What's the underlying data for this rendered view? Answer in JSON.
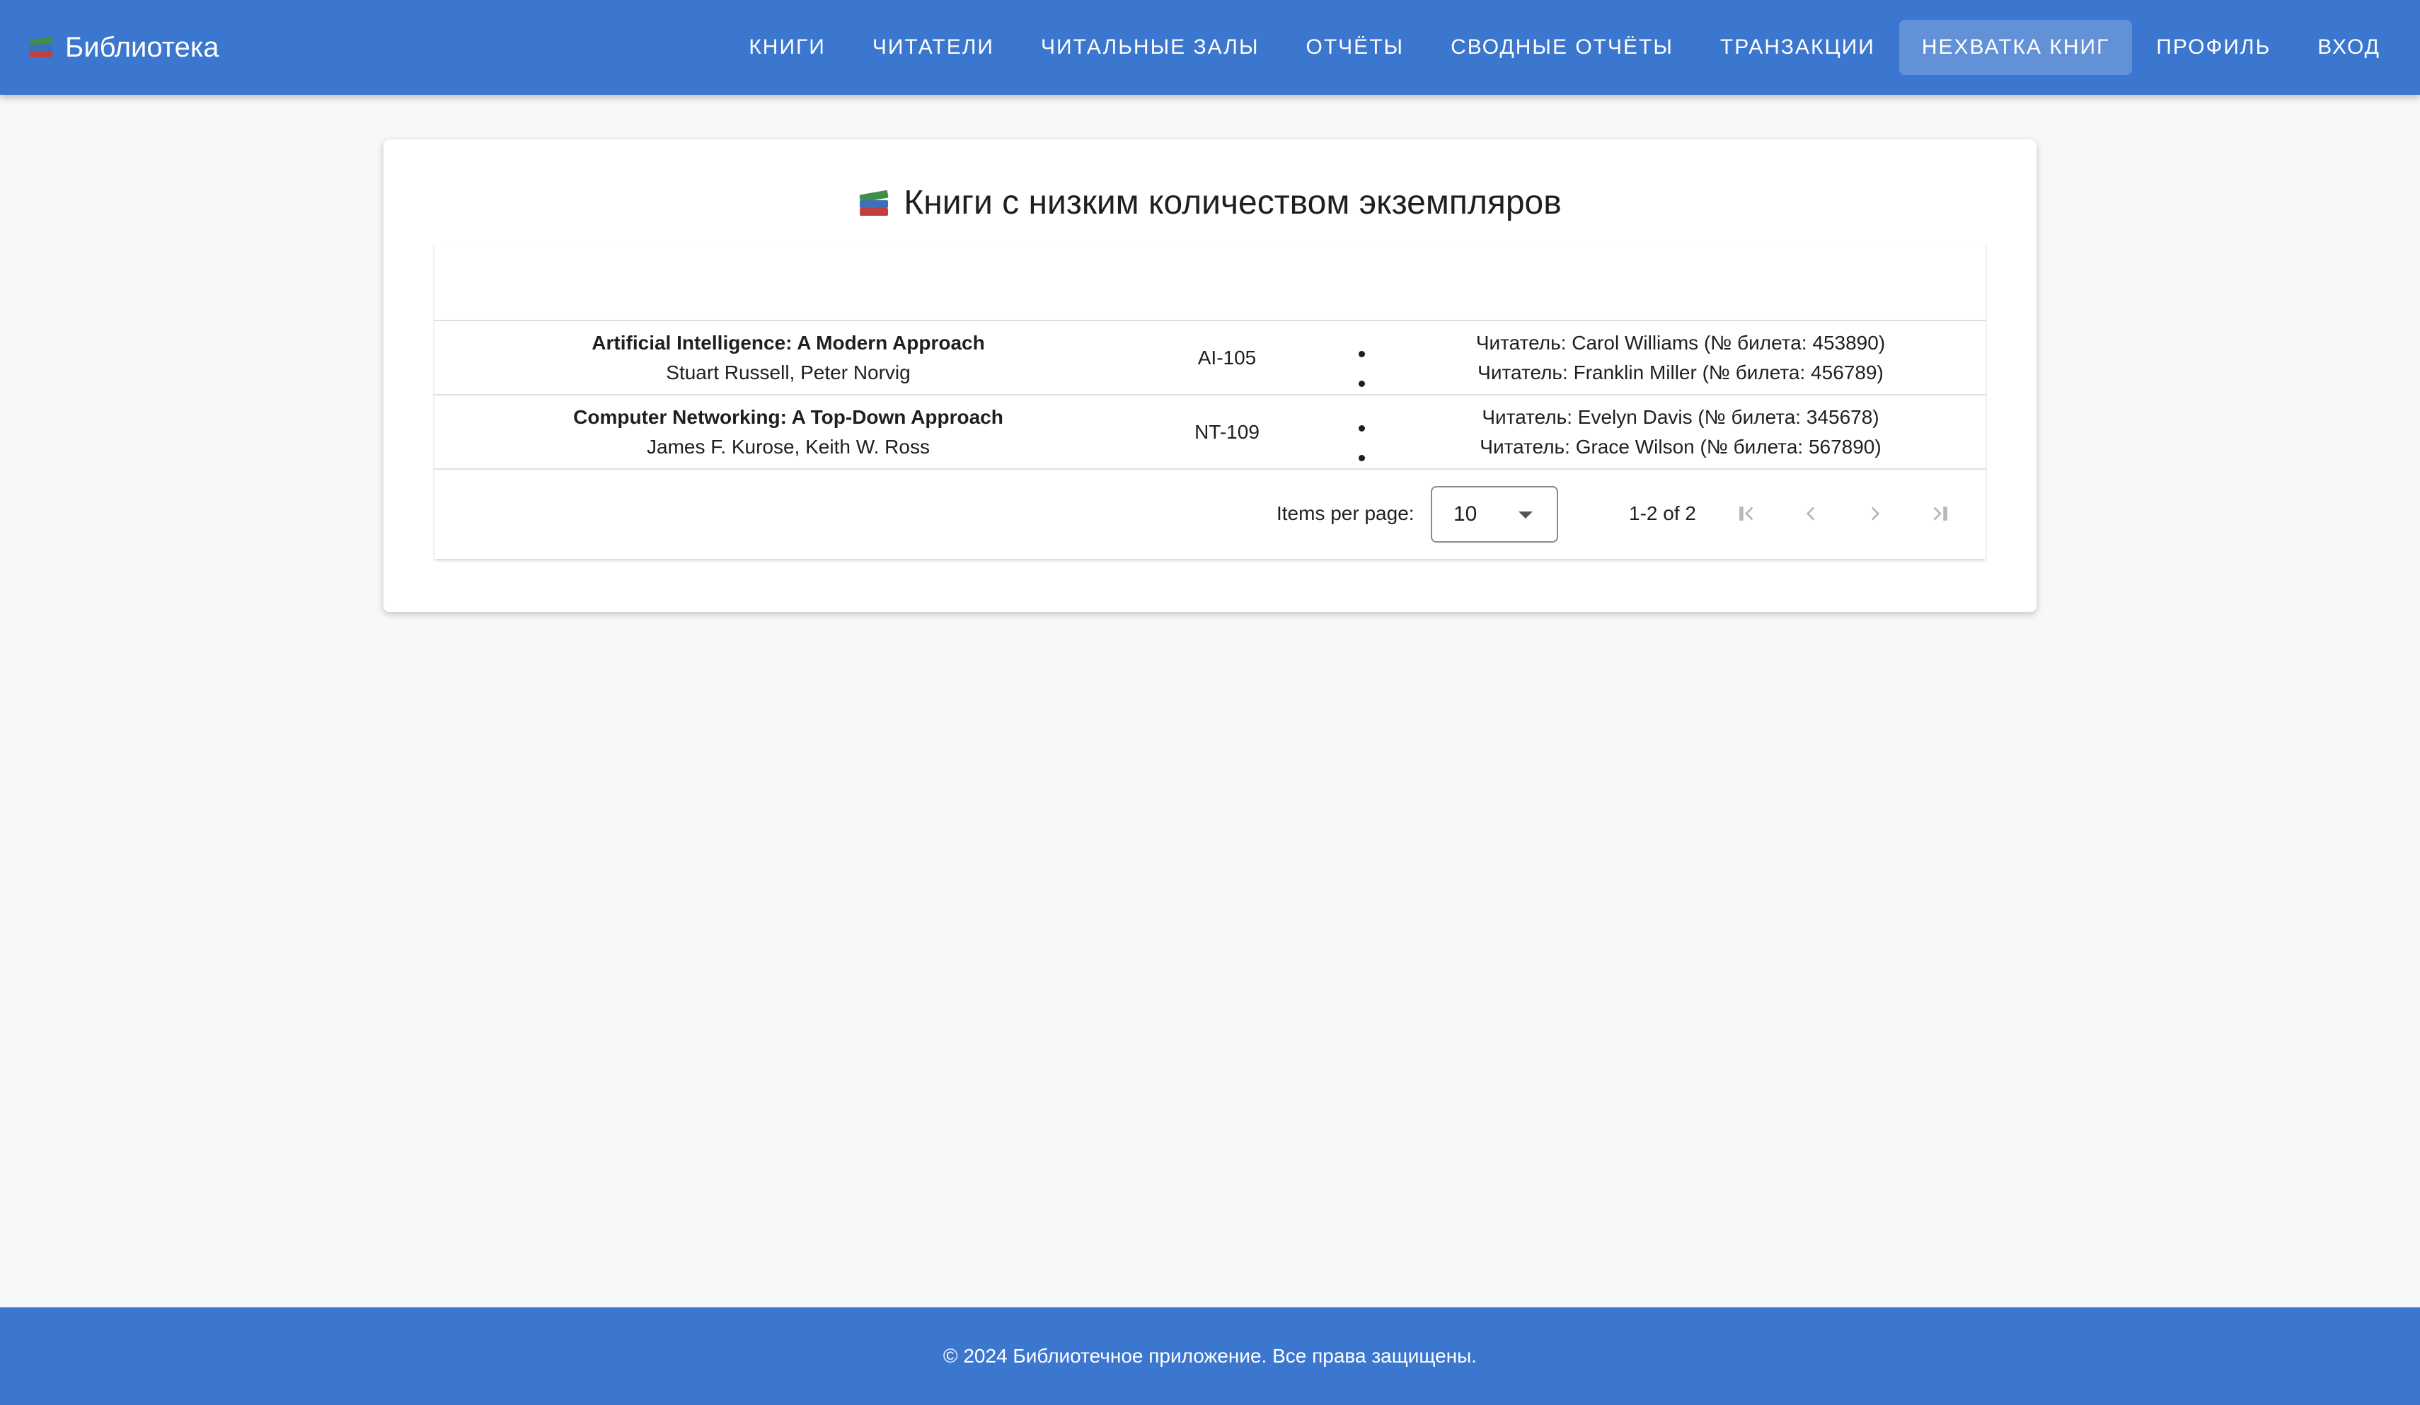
{
  "header": {
    "brand": "Библиотека",
    "nav": [
      {
        "label": "КНИГИ"
      },
      {
        "label": "ЧИТАТЕЛИ"
      },
      {
        "label": "ЧИТАЛЬНЫЕ ЗАЛЫ"
      },
      {
        "label": "ОТЧЁТЫ"
      },
      {
        "label": "СВОДНЫЕ ОТЧЁТЫ"
      },
      {
        "label": "ТРАНЗАКЦИИ"
      },
      {
        "label": "НЕХВАТКА КНИГ",
        "active": true
      },
      {
        "label": "ПРОФИЛЬ"
      },
      {
        "label": "ВХОД"
      }
    ]
  },
  "main": {
    "title": "Книги с низким количеством экземпляров",
    "rows": [
      {
        "title": "Artificial Intelligence: A Modern Approach",
        "authors": "Stuart Russell, Peter Norvig",
        "code": "AI-105",
        "readers": [
          "Читатель: Carol Williams (№ билета: 453890)",
          "Читатель: Franklin Miller (№ билета: 456789)"
        ]
      },
      {
        "title": "Computer Networking: A Top-Down Approach",
        "authors": "James F. Kurose, Keith W. Ross",
        "code": "NT-109",
        "readers": [
          "Читатель: Evelyn Davis (№ билета: 345678)",
          "Читатель: Grace Wilson (№ билета: 567890)"
        ]
      }
    ],
    "paginator": {
      "items_per_page_label": "Items per page:",
      "items_per_page": "10",
      "range": "1-2 of 2"
    }
  },
  "footer": {
    "text": "© 2024 Библиотечное приложение. Все права защищены."
  },
  "colors": {
    "primary": "#3b76cf",
    "background": "#f6f8fa"
  },
  "icons": {
    "brand": "books-icon",
    "paginator": [
      "first-page-icon",
      "prev-page-icon",
      "next-page-icon",
      "last-page-icon"
    ]
  }
}
